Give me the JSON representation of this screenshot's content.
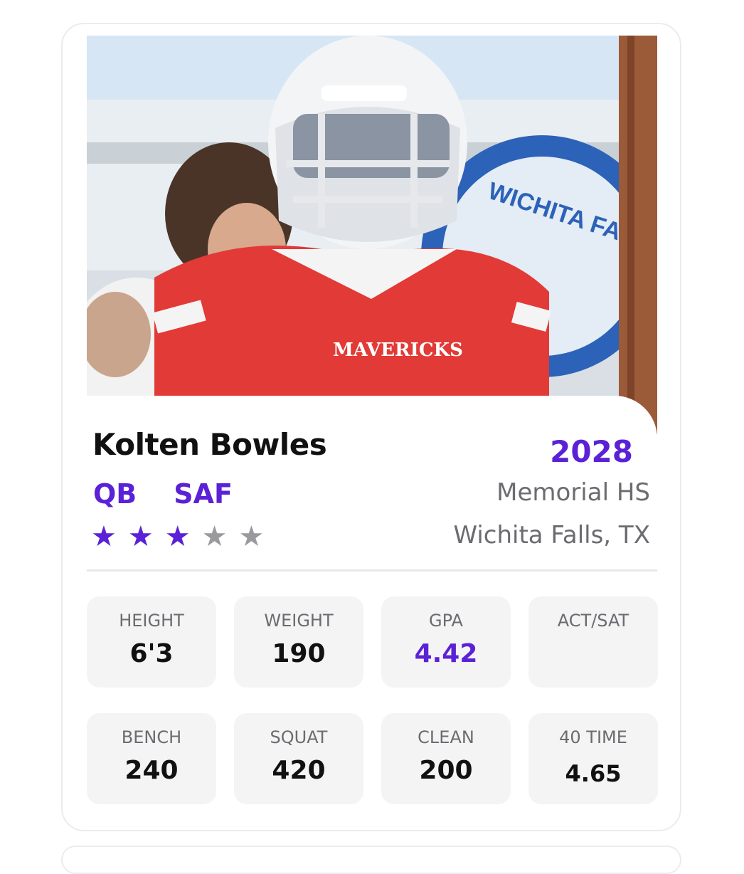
{
  "player": {
    "name": "Kolten Bowles",
    "class_year": "2028",
    "positions": [
      "QB",
      "SAF"
    ],
    "school": "Memorial HS",
    "location": "Wichita Falls, TX",
    "rating": {
      "filled": 3,
      "total": 5
    }
  },
  "photo": {
    "jersey_text": "MAVERICKS",
    "background_sign_text": "WICHITA FA"
  },
  "stats": [
    {
      "label": "HEIGHT",
      "value": "6'3"
    },
    {
      "label": "WEIGHT",
      "value": "190"
    },
    {
      "label": "GPA",
      "value": "4.42"
    },
    {
      "label": "ACT/SAT",
      "value": ""
    },
    {
      "label": "BENCH",
      "value": "240"
    },
    {
      "label": "SQUAT",
      "value": "420"
    },
    {
      "label": "CLEAN",
      "value": "200"
    },
    {
      "label": "40 TIME",
      "value": "4.65"
    }
  ],
  "colors": {
    "accent": "#5b21d6",
    "star_filled": "#5b21d6",
    "star_empty": "#9a9a9e",
    "jersey_red": "#e23a36"
  }
}
